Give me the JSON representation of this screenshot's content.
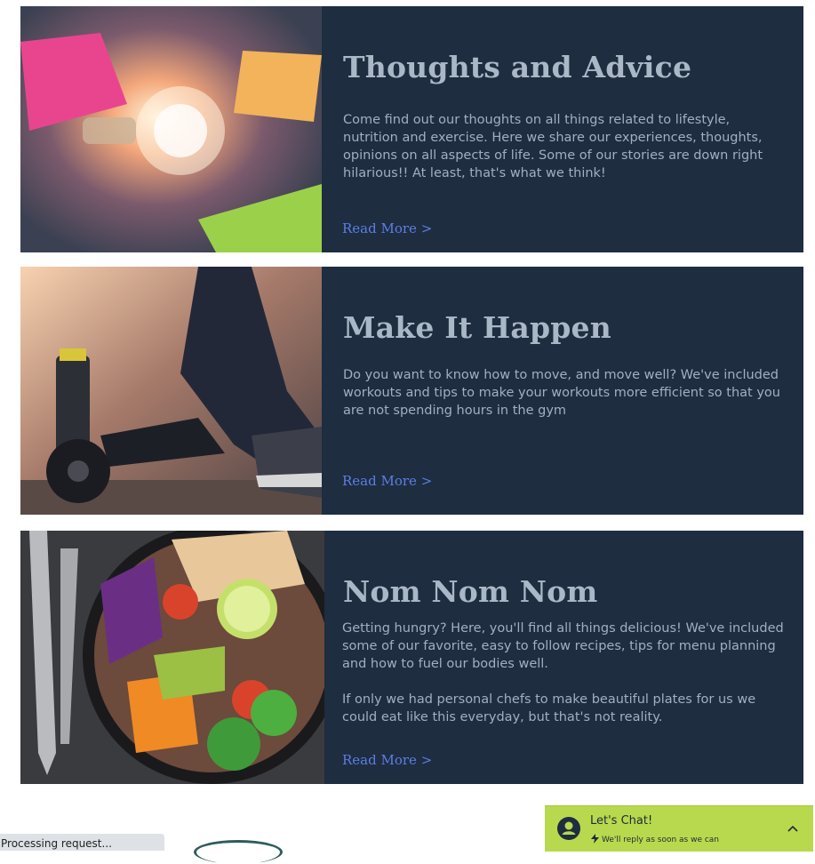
{
  "cards": [
    {
      "title": "Thoughts and Advice",
      "paragraphs": [
        "Come find out our thoughts on all things related to lifestyle, nutrition and exercise. Here we share our experiences, thoughts, opinions on all aspects of life. Some of our stories are down right hilarious!! At least, that's what we think!"
      ],
      "link": "Read More >",
      "image": "lightbulb-sticky-notes-photo"
    },
    {
      "title": "Make It Happen",
      "paragraphs": [
        "Do you want to know how to move, and move well? We've included workouts and tips to make your workouts more efficient so that you are not spending hours in the gym"
      ],
      "link": "Read More >",
      "image": "gym-dumbbell-sneaker-photo"
    },
    {
      "title": "Nom Nom Nom",
      "paragraphs": [
        "Getting hungry? Here, you'll find all things delicious! We've included some of our favorite, easy to follow recipes, tips for menu planning and how to fuel our bodies well.",
        "If only we had personal chefs to make beautiful plates for us we could eat like this everyday, but that's not reality."
      ],
      "link": "Read More >",
      "image": "salad-bowl-forks-photo"
    }
  ],
  "status_bar": {
    "text": "Processing request..."
  },
  "chat": {
    "title": "Let's Chat!",
    "subtitle": "We'll reply as soon as we can",
    "icons": [
      "user-avatar-icon",
      "lightning-icon",
      "chevron-up-icon"
    ]
  },
  "colors": {
    "card_bg": "#1e2d40",
    "title": "#aab7c7",
    "body": "#9fb0c2",
    "link": "#5b7fe3",
    "chat_bg": "#b8d94e"
  }
}
